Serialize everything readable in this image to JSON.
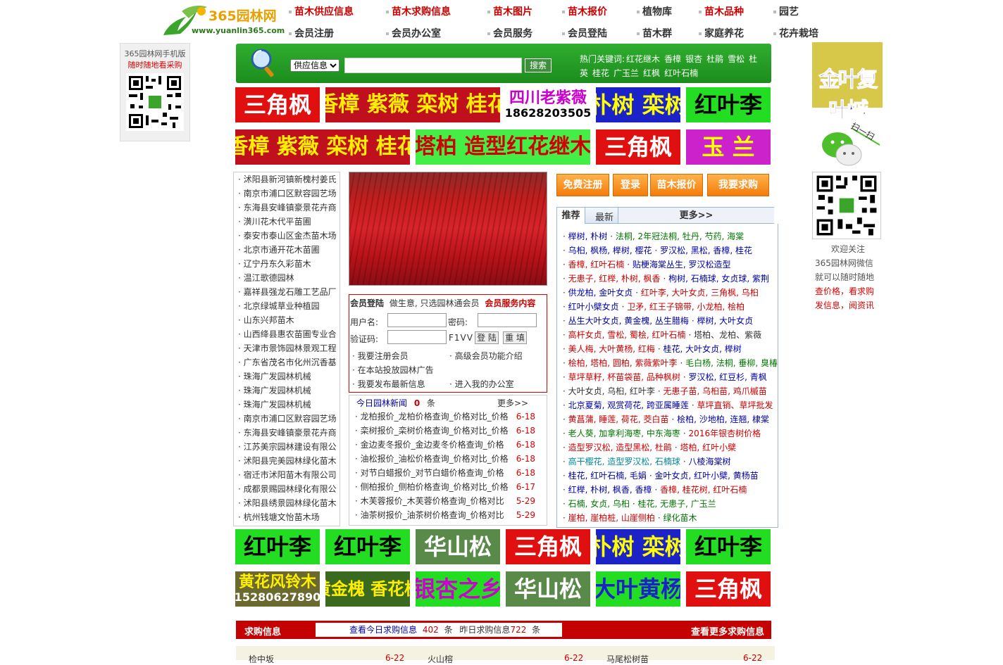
{
  "logo": {
    "name": "365园林网",
    "url": "www.yuanlin365.com"
  },
  "nav": [
    {
      "label": "苗木供应信息",
      "color": "red"
    },
    {
      "label": "苗木求购信息",
      "color": "red"
    },
    {
      "label": "苗木图片",
      "color": "red"
    },
    {
      "label": "苗木报价",
      "color": "red"
    },
    {
      "label": "植物库",
      "color": "dark"
    },
    {
      "label": "苗木品种",
      "color": "red"
    },
    {
      "label": "园艺",
      "color": "dark"
    },
    {
      "label": "会员注册",
      "color": "dark"
    },
    {
      "label": "会员办公室",
      "color": "dark"
    },
    {
      "label": "会员服务",
      "color": "dark"
    },
    {
      "label": "会员登陆",
      "color": "dark"
    },
    {
      "label": "苗木群",
      "color": "dark"
    },
    {
      "label": "家庭养花",
      "color": "dark"
    },
    {
      "label": "花卉栽培",
      "color": "dark"
    }
  ],
  "left_qr": {
    "line1": "365园林网手机版",
    "line2": "随时随地看采购"
  },
  "right_ad": {
    "text": "金叶复叶槭"
  },
  "right_qr": {
    "scan": "扫一扫",
    "line1": "欢迎关注",
    "line2": "365园林网微信",
    "line3": "就可以随时随地",
    "line4": "查价格，看求购",
    "line5": "发信息，阅资讯"
  },
  "search": {
    "select": "供应信息",
    "button": "搜索",
    "hot_label": "热门关键词:",
    "hot": [
      "红花继木",
      "香樟",
      "银杏",
      "杜鹃",
      "雪松",
      "杜英",
      "桂花",
      "广玉兰",
      "红枫",
      "红叶石楠"
    ]
  },
  "banners_row1": [
    {
      "text": "三角枫",
      "bg": "#e01010",
      "fg": "#ffffff"
    },
    {
      "text": "香樟 紫薇 栾树 桂花",
      "bg": "#c0101e",
      "fg": "#ffee00"
    },
    {
      "text": "四川老紫薇",
      "sub": "18628203505",
      "bg": "#ffffff",
      "fg": "#cc00cc"
    },
    {
      "text": "朴树 栾树",
      "bg": "#1a22c8",
      "fg": "#ffff00"
    },
    {
      "text": "红叶李",
      "bg": "#22dd22",
      "fg": "#000000"
    }
  ],
  "banners_row2": [
    {
      "text": "香樟 紫薇 栾树 桂花",
      "bg": "#c0101e",
      "fg": "#ffee00"
    },
    {
      "text": "塔柏 造型红花继木",
      "bg": "#44ee44",
      "fg": "#d00000"
    },
    {
      "text": "三角枫",
      "bg": "#e01010",
      "fg": "#ffffff"
    },
    {
      "text": "玉 兰",
      "bg": "#cc22cc",
      "fg": "#ffff00"
    }
  ],
  "banners_row3": [
    {
      "text": "红叶李",
      "bg": "#22dd22",
      "fg": "#000000"
    },
    {
      "text": "红叶李",
      "bg": "#22dd22",
      "fg": "#000000"
    },
    {
      "text": "华山松",
      "bg": "#5a8a4a",
      "fg": "#ffffff"
    },
    {
      "text": "三角枫",
      "bg": "#e01010",
      "fg": "#ffffff"
    },
    {
      "text": "朴树 栾树",
      "bg": "#1a22c8",
      "fg": "#ffff00"
    },
    {
      "text": "红叶李",
      "bg": "#22dd22",
      "fg": "#000000"
    }
  ],
  "banners_row4": [
    {
      "text": "黄花风铃木",
      "sub": "15280627890",
      "bg": "#6a6a30",
      "fg": "#ffee00"
    },
    {
      "text": "黄金槐 香花槐",
      "bg": "#3a6a20",
      "fg": "#ffee00"
    },
    {
      "text": "银杏之乡",
      "bg": "#22dd22",
      "fg": "#cc00cc"
    },
    {
      "text": "华山松",
      "bg": "#5a8a4a",
      "fg": "#ffffff"
    },
    {
      "text": "大叶黄杨",
      "bg": "#22dd22",
      "fg": "#1a22c8"
    },
    {
      "text": "三角枫",
      "bg": "#e01010",
      "fg": "#ffffff"
    }
  ],
  "supply_list": [
    "沭阳县新河镇新槐村姜氏",
    "南京市浦口区默容园艺场",
    "东海县安峰镇豪景花卉商",
    "潢川花木代平苗圃",
    "泰安市泰山区金杰苗木场",
    "北京市通开花木苗圃",
    "辽宁丹东久彩苗木",
    "温江歌德园林",
    "嘉祥县强龙石雕工艺品厂",
    "北京绿城草业种植园",
    "山东兴邦苗木",
    "山西绛县惠农苗圃专业合",
    "天津市景饰园林景观工程",
    "广东省茂名市化州沉香基",
    "珠海广发园林机械",
    "珠海广发园林机械",
    "珠海广发园林机械",
    "南京市浦口区默容园艺场",
    "东海县安峰镇豪景花卉商",
    "江苏美宗园林建设有限公",
    "沭阳县完美园林绿化苗木",
    "宿迁市沭阳苗木有限公司",
    "成都景赐园林绿化有限公",
    "沭阳县绣景园林绿化苗木",
    "杭州钱塘文怡苗木场"
  ],
  "login": {
    "title": "会员登陆",
    "slogan": "做生意, 只选园林通会员",
    "service": "会员服务内容",
    "user_label": "用户名:",
    "pwd_label": "密码:",
    "code_label": "验证码:",
    "code": "F1VV",
    "login_btn": "登 陆",
    "reset_btn": "重 填",
    "links": [
      "我要注册会员",
      "高级会员功能介绍",
      "在本站投放园林广告",
      "我要发布最新信息",
      "进入我的办公室"
    ]
  },
  "news": {
    "title": "今日园林新闻",
    "count": "0",
    "unit": "条",
    "more": "更多>>",
    "items": [
      {
        "t": "龙柏报价_龙柏价格查询_价格对比_价格",
        "d": "6-18"
      },
      {
        "t": "栾树报价_栾树价格查询_价格对比_价格",
        "d": "6-18"
      },
      {
        "t": "金边麦冬报价_金边麦冬价格查询_价格",
        "d": "6-18"
      },
      {
        "t": "油松报价_油松价格查询_价格对比_价格",
        "d": "6-18"
      },
      {
        "t": "对节白蜡报价_对节白蜡价格查询_价格",
        "d": "6-18"
      },
      {
        "t": "侧柏报价_侧柏价格查询_价格对比_价格",
        "d": "6-17"
      },
      {
        "t": "木芙蓉报价_木芙蓉价格查询_价格对比",
        "d": "5-29"
      },
      {
        "t": "油茶树报价_油茶树价格查询_价格对比",
        "d": "5-29"
      }
    ]
  },
  "action_buttons": [
    "免费注册",
    "登录",
    "苗木报价",
    "我要求购"
  ],
  "tabs": {
    "tab1": "推荐",
    "tab2": "最新",
    "more": "更多>>"
  },
  "rec_list": [
    [
      [
        "榉树, 朴树",
        "#00a"
      ],
      [
        "法桐, 2年冠法桐, 牡丹, 芍药, 海棠",
        "#070"
      ]
    ],
    [
      [
        "乌桕, 枫杨, 榉树, 樱花",
        "#00a"
      ],
      [
        "罗汉松, 黑松, 香樟, 桂花",
        "#00a"
      ]
    ],
    [
      [
        "香樟, 红叶石楠",
        "#c00"
      ],
      [
        "贴梗海棠丛生, 罗汉松造型",
        "#00a"
      ]
    ],
    [
      [
        "无患子, 红榉, 朴树, 枫香",
        "#c00"
      ],
      [
        "枸树, 石楠球, 女贞球, 紫荆",
        "#00a"
      ]
    ],
    [
      [
        "供龙柏, 金叶女贞",
        "#00a"
      ],
      [
        "红叶李, 大叶女贞, 三角枫, 乌桕",
        "#c00"
      ]
    ],
    [
      [
        "红叶小檗女贞",
        "#00a"
      ],
      [
        "卫矛, 红王子锦带, 小龙柏, 桧柏",
        "#c00"
      ]
    ],
    [
      [
        "丛生大叶女贞, 黄金槐, 丛生腊梅",
        "#00a"
      ],
      [
        "榉树, 大叶女贞",
        "#00a"
      ]
    ],
    [
      [
        "高杆女贞, 雪松, 蜀桧, 红叶石楠",
        "#c00"
      ],
      [
        "塔柏、龙柏、紫薇",
        "#333"
      ]
    ],
    [
      [
        "美人梅, 大叶黄杨, 红梅",
        "#c00"
      ],
      [
        "桂花, 大叶女贞, 榉树",
        "#00a"
      ]
    ],
    [
      [
        "桧柏, 塔柏, 圆柏, 紫薇紫叶李",
        "#c00"
      ],
      [
        "毛白杨, 法桐, 垂柳, 臭椿",
        "#070"
      ]
    ],
    [
      [
        "草坪草籽, 杯苗袋苗, 品种枫树",
        "#c00"
      ],
      [
        "罗汉松, 红豆杉, 青枫",
        "#00a"
      ]
    ],
    [
      [
        "大叶女贞, 乌桕, 红叶李",
        "#333"
      ],
      [
        "无患子苗, 乌桕苗, 鸡爪槭苗",
        "#c00"
      ]
    ],
    [
      [
        "北京夏菊, 观赏荷花, 跨亚属睡莲",
        "#00a"
      ],
      [
        "草坪直销、草坪批发",
        "#c00"
      ]
    ],
    [
      [
        "黄菖蒲, 睡莲, 荷花, 茭白苗",
        "#c00"
      ],
      [
        "桧柏, 沙地柏, 连翘, 棣棠",
        "#00a"
      ]
    ],
    [
      [
        "老人葵, 加拿利海枣, 中东海枣",
        "#070"
      ],
      [
        "2016年银杏树价格",
        "#c00"
      ]
    ],
    [
      [
        "造型罗汉松, 造型黑松, 杜鹃",
        "#c00"
      ],
      [
        "塔柏, 红叶小檗",
        "#c00"
      ]
    ],
    [
      [
        "高干樱花, 造型罗汉松, 石楠球",
        "#089"
      ],
      [
        "八棱海棠树",
        "#00a"
      ]
    ],
    [
      [
        "桂花, 红叶石楠, 毛娟",
        "#00a"
      ],
      [
        "金叶女贞, 红叶小檗, 黄杨苗",
        "#00a"
      ]
    ],
    [
      [
        "红榉, 朴树, 枫香, 香樟",
        "#00a"
      ],
      [
        "香樟, 桂花树, 红叶石楠",
        "#c00"
      ]
    ],
    [
      [
        "石楠, 女贞, 乌桕",
        "#070"
      ],
      [
        "桂花, 无患子, 广玉兰",
        "#070"
      ]
    ],
    [
      [
        "崖柏, 崖柏桩, 山崖侧柏",
        "#c00"
      ],
      [
        "绿化苗木",
        "#070"
      ]
    ]
  ],
  "buy": {
    "title": "求购信息",
    "today_label": "查看今日求购信息",
    "today": "402",
    "unit": "条",
    "yest_label": "昨日求购信息",
    "yest": "722",
    "more": "查看更多求购信息",
    "row": [
      "检中坂",
      "6-22",
      "火山榕",
      "6-22",
      "马尾松树苗",
      "6-22"
    ]
  }
}
